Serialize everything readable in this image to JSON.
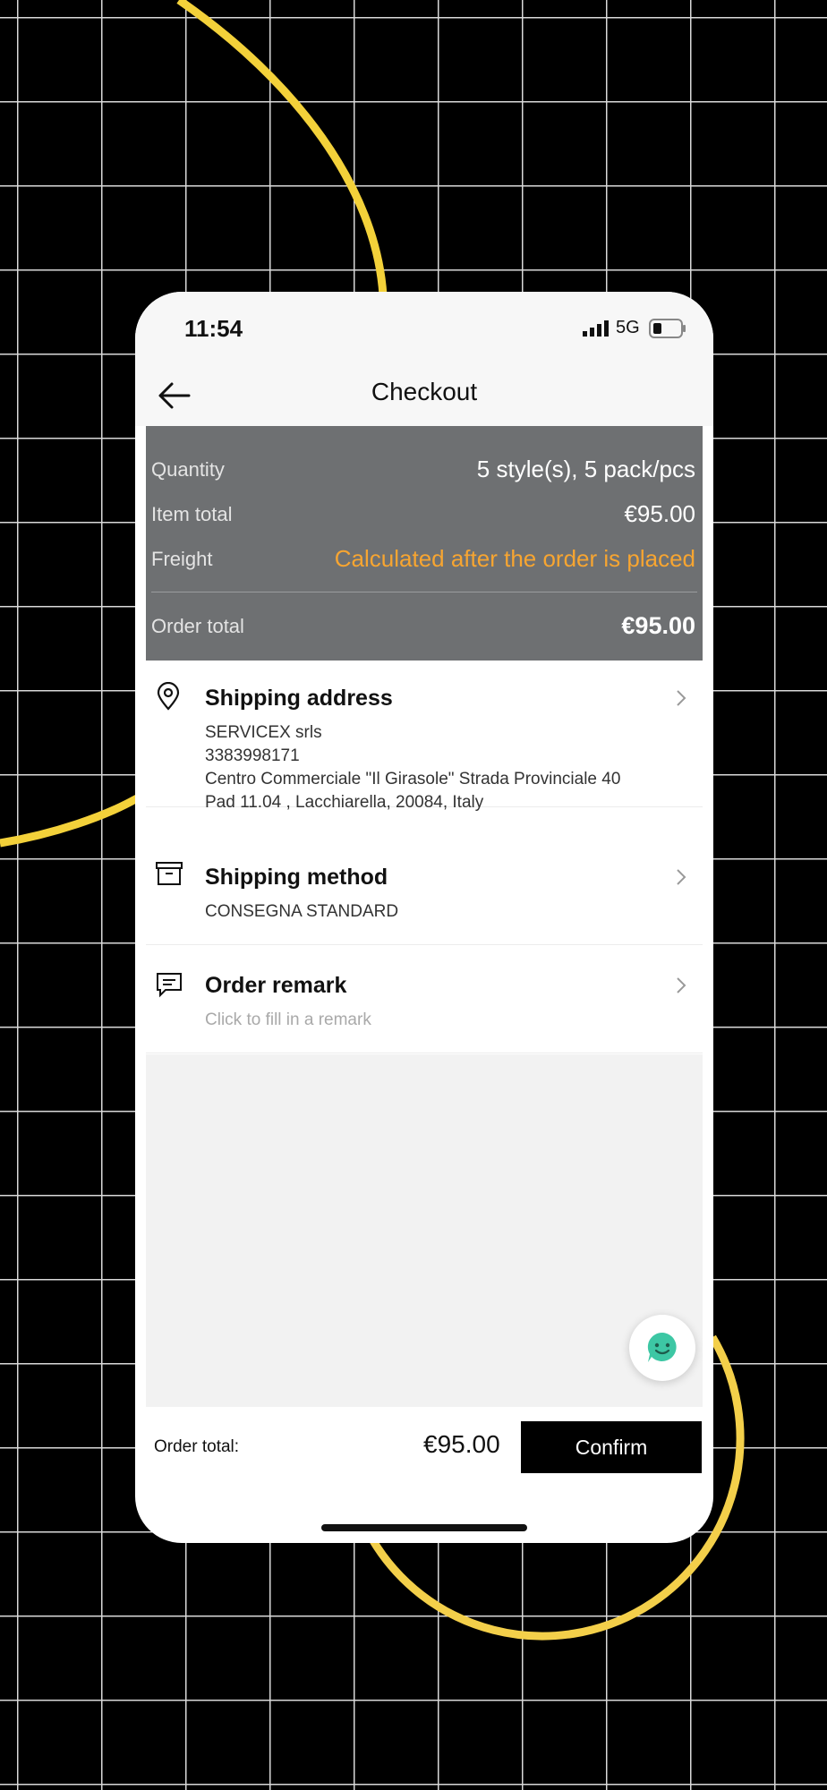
{
  "status_bar": {
    "time": "11:54",
    "network": "5G"
  },
  "nav": {
    "title": "Checkout"
  },
  "summary": {
    "quantity": {
      "label": "Quantity",
      "value": "5 style(s), 5 pack/pcs"
    },
    "item_total": {
      "label": "Item total",
      "value": "€95.00"
    },
    "freight": {
      "label": "Freight",
      "value": "Calculated after the order is placed"
    },
    "order_total": {
      "label": "Order total",
      "value": "€95.00"
    }
  },
  "shipping_address": {
    "title": "Shipping address",
    "name": "SERVICEX srls",
    "phone": "3383998171",
    "address_line1": "Centro Commerciale \"Il Girasole\" Strada Provinciale 40",
    "address_line2": "Pad 11.04 , Lacchiarella, 20084, Italy"
  },
  "shipping_method": {
    "title": "Shipping method",
    "value": "CONSEGNA STANDARD"
  },
  "order_remark": {
    "title": "Order remark",
    "placeholder": "Click to fill in a remark"
  },
  "bottom_bar": {
    "label": "Order total:",
    "total": "€95.00",
    "confirm_label": "Confirm"
  },
  "colors": {
    "accent_orange": "#f7a531",
    "summary_bg": "#6e7072",
    "decoration_yellow": "#f3d13a",
    "chat_teal": "#3dc7a4"
  },
  "icons": [
    "back-arrow-icon",
    "location-pin-icon",
    "package-box-icon",
    "message-icon",
    "chevron-right-icon",
    "chat-support-icon",
    "signal-icon",
    "battery-icon"
  ]
}
